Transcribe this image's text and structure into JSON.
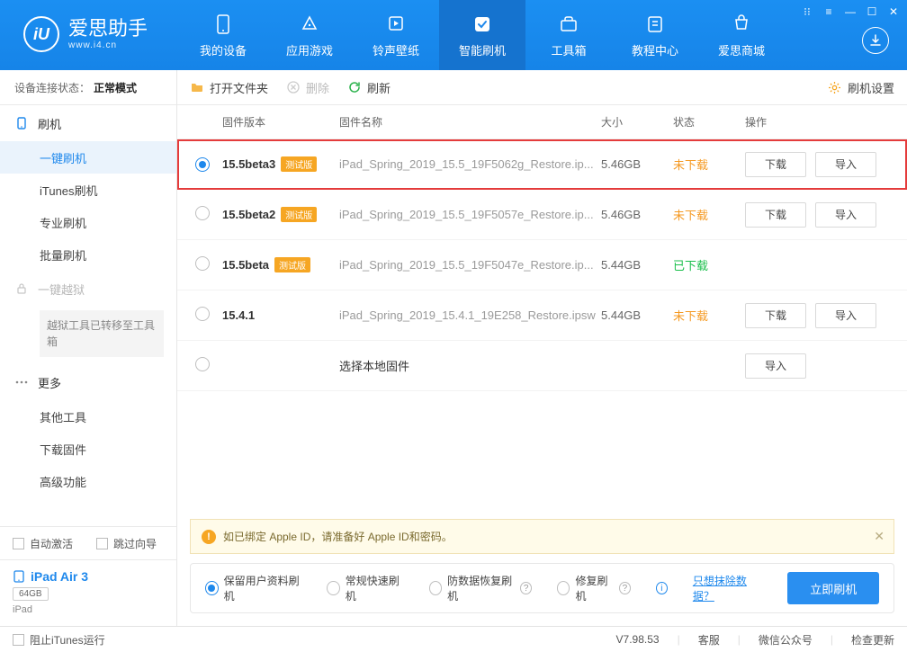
{
  "brand": {
    "title": "爱思助手",
    "subtitle": "www.i4.cn",
    "logo_letter": "iU"
  },
  "topnav": {
    "items": [
      {
        "label": "我的设备"
      },
      {
        "label": "应用游戏"
      },
      {
        "label": "铃声壁纸"
      },
      {
        "label": "智能刷机"
      },
      {
        "label": "工具箱"
      },
      {
        "label": "教程中心"
      },
      {
        "label": "爱思商城"
      }
    ],
    "active_index": 3
  },
  "sidebar": {
    "status_label": "设备连接状态：",
    "status_value": "正常模式",
    "sections": {
      "flash": {
        "head": "刷机",
        "items": [
          "一键刷机",
          "iTunes刷机",
          "专业刷机",
          "批量刷机"
        ],
        "active_index": 0
      },
      "jailbreak": {
        "head": "一键越狱",
        "note": "越狱工具已转移至工具箱"
      },
      "more": {
        "head": "更多",
        "items": [
          "其他工具",
          "下载固件",
          "高级功能"
        ]
      }
    },
    "options": {
      "auto_activate": "自动激活",
      "skip_guide": "跳过向导"
    },
    "device": {
      "name": "iPad Air 3",
      "storage": "64GB",
      "type": "iPad"
    }
  },
  "toolbar": {
    "open_folder": "打开文件夹",
    "delete": "删除",
    "refresh": "刷新",
    "settings": "刷机设置"
  },
  "table": {
    "headers": {
      "version": "固件版本",
      "name": "固件名称",
      "size": "大小",
      "status": "状态",
      "ops": "操作"
    },
    "op_download": "下载",
    "op_import": "导入",
    "beta_badge": "测试版",
    "rows": [
      {
        "version": "15.5beta3",
        "beta": true,
        "name": "iPad_Spring_2019_15.5_19F5062g_Restore.ip...",
        "size": "5.46GB",
        "status": "未下载",
        "status_cls": "status-not",
        "selected": true,
        "highlight": true,
        "ops": [
          "download",
          "import"
        ]
      },
      {
        "version": "15.5beta2",
        "beta": true,
        "name": "iPad_Spring_2019_15.5_19F5057e_Restore.ip...",
        "size": "5.46GB",
        "status": "未下载",
        "status_cls": "status-not",
        "selected": false,
        "ops": [
          "download",
          "import"
        ]
      },
      {
        "version": "15.5beta",
        "beta": true,
        "name": "iPad_Spring_2019_15.5_19F5047e_Restore.ip...",
        "size": "5.44GB",
        "status": "已下载",
        "status_cls": "status-done",
        "selected": false,
        "ops": []
      },
      {
        "version": "15.4.1",
        "beta": false,
        "name": "iPad_Spring_2019_15.4.1_19E258_Restore.ipsw",
        "size": "5.44GB",
        "status": "未下载",
        "status_cls": "status-not",
        "selected": false,
        "ops": [
          "download",
          "import"
        ]
      },
      {
        "version": "",
        "beta": false,
        "name_dark": "选择本地固件",
        "size": "",
        "status": "",
        "status_cls": "",
        "selected": false,
        "ops": [
          "import"
        ]
      }
    ]
  },
  "notice": "如已绑定 Apple ID，请准备好 Apple ID和密码。",
  "flash_options": {
    "items": [
      {
        "label": "保留用户资料刷机",
        "checked": true,
        "help": false
      },
      {
        "label": "常规快速刷机",
        "checked": false,
        "help": false
      },
      {
        "label": "防数据恢复刷机",
        "checked": false,
        "help": true
      },
      {
        "label": "修复刷机",
        "checked": false,
        "help": true
      }
    ],
    "erase_link": "只想抹除数据？",
    "primary": "立即刷机"
  },
  "statusbar": {
    "block_itunes": "阻止iTunes运行",
    "version": "V7.98.53",
    "service": "客服",
    "wechat": "微信公众号",
    "check_update": "检查更新"
  }
}
